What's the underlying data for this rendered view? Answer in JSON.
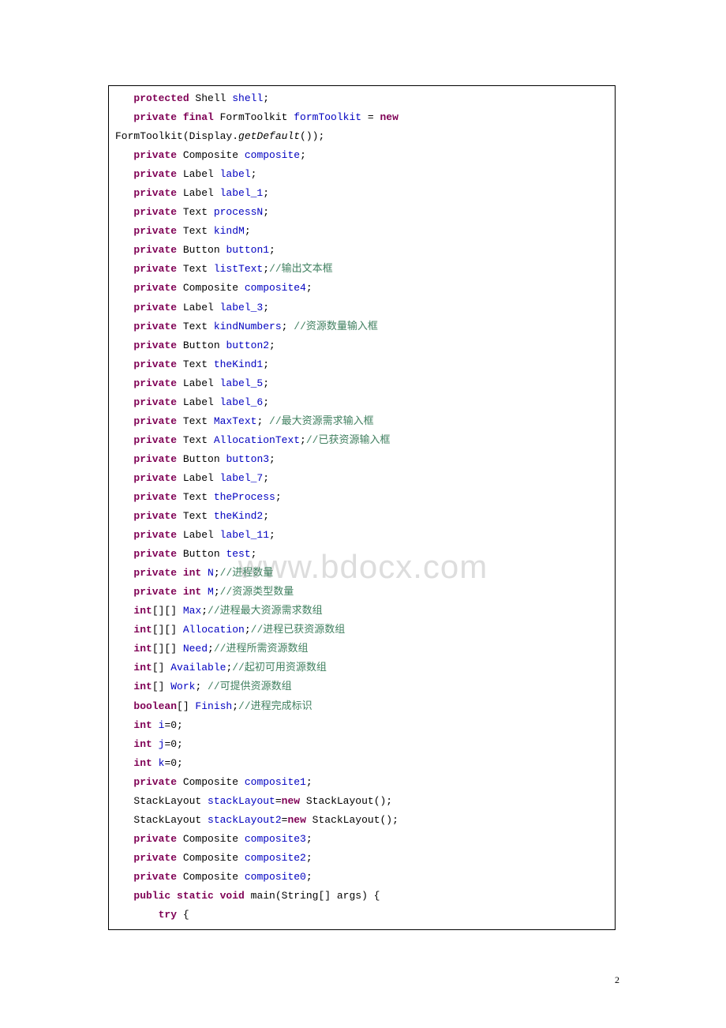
{
  "watermark": "www.bdocx.com",
  "page_number": "2",
  "lines": [
    [
      {
        "t": "   "
      },
      {
        "t": "protected",
        "c": "kw"
      },
      {
        "t": " Shell "
      },
      {
        "t": "shell",
        "c": "fld"
      },
      {
        "t": ";"
      }
    ],
    [
      {
        "t": "   "
      },
      {
        "t": "private final",
        "c": "kw"
      },
      {
        "t": " FormToolkit "
      },
      {
        "t": "formToolkit",
        "c": "fld"
      },
      {
        "t": " = "
      },
      {
        "t": "new",
        "c": "kw"
      }
    ],
    [
      {
        "t": "FormToolkit(Display."
      },
      {
        "t": "getDefault",
        "c": "sit"
      },
      {
        "t": "());"
      }
    ],
    [
      {
        "t": "   "
      },
      {
        "t": "private",
        "c": "kw"
      },
      {
        "t": " Composite "
      },
      {
        "t": "composite",
        "c": "fld"
      },
      {
        "t": ";"
      }
    ],
    [
      {
        "t": "   "
      },
      {
        "t": "private",
        "c": "kw"
      },
      {
        "t": " Label "
      },
      {
        "t": "label",
        "c": "fld"
      },
      {
        "t": ";"
      }
    ],
    [
      {
        "t": "   "
      },
      {
        "t": "private",
        "c": "kw"
      },
      {
        "t": " Label "
      },
      {
        "t": "label_1",
        "c": "fld"
      },
      {
        "t": ";"
      }
    ],
    [
      {
        "t": "   "
      },
      {
        "t": "private",
        "c": "kw"
      },
      {
        "t": " Text "
      },
      {
        "t": "processN",
        "c": "fld"
      },
      {
        "t": ";"
      }
    ],
    [
      {
        "t": "   "
      },
      {
        "t": "private",
        "c": "kw"
      },
      {
        "t": " Text "
      },
      {
        "t": "kindM",
        "c": "fld"
      },
      {
        "t": ";"
      }
    ],
    [
      {
        "t": "   "
      },
      {
        "t": "private",
        "c": "kw"
      },
      {
        "t": " Button "
      },
      {
        "t": "button1",
        "c": "fld"
      },
      {
        "t": ";"
      }
    ],
    [
      {
        "t": "   "
      },
      {
        "t": "private",
        "c": "kw"
      },
      {
        "t": " Text "
      },
      {
        "t": "listText",
        "c": "fld"
      },
      {
        "t": ";"
      },
      {
        "t": "//输出文本框",
        "c": "cm"
      }
    ],
    [
      {
        "t": "   "
      },
      {
        "t": "private",
        "c": "kw"
      },
      {
        "t": " Composite "
      },
      {
        "t": "composite4",
        "c": "fld"
      },
      {
        "t": ";"
      }
    ],
    [
      {
        "t": "   "
      },
      {
        "t": "private",
        "c": "kw"
      },
      {
        "t": " Label "
      },
      {
        "t": "label_3",
        "c": "fld"
      },
      {
        "t": ";"
      }
    ],
    [
      {
        "t": "   "
      },
      {
        "t": "private",
        "c": "kw"
      },
      {
        "t": " Text "
      },
      {
        "t": "kindNumbers",
        "c": "fld"
      },
      {
        "t": "; "
      },
      {
        "t": "//资源数量输入框",
        "c": "cm"
      }
    ],
    [
      {
        "t": "   "
      },
      {
        "t": "private",
        "c": "kw"
      },
      {
        "t": " Button "
      },
      {
        "t": "button2",
        "c": "fld"
      },
      {
        "t": ";"
      }
    ],
    [
      {
        "t": "   "
      },
      {
        "t": "private",
        "c": "kw"
      },
      {
        "t": " Text "
      },
      {
        "t": "theKind1",
        "c": "fld"
      },
      {
        "t": ";"
      }
    ],
    [
      {
        "t": "   "
      },
      {
        "t": "private",
        "c": "kw"
      },
      {
        "t": " Label "
      },
      {
        "t": "label_5",
        "c": "fld"
      },
      {
        "t": ";"
      }
    ],
    [
      {
        "t": "   "
      },
      {
        "t": "private",
        "c": "kw"
      },
      {
        "t": " Label "
      },
      {
        "t": "label_6",
        "c": "fld"
      },
      {
        "t": ";"
      }
    ],
    [
      {
        "t": "   "
      },
      {
        "t": "private",
        "c": "kw"
      },
      {
        "t": " Text "
      },
      {
        "t": "MaxText",
        "c": "fld"
      },
      {
        "t": "; "
      },
      {
        "t": "//最大资源需求输入框",
        "c": "cm"
      }
    ],
    [
      {
        "t": "   "
      },
      {
        "t": "private",
        "c": "kw"
      },
      {
        "t": " Text "
      },
      {
        "t": "AllocationText",
        "c": "fld"
      },
      {
        "t": ";"
      },
      {
        "t": "//已获资源输入框",
        "c": "cm"
      }
    ],
    [
      {
        "t": "   "
      },
      {
        "t": "private",
        "c": "kw"
      },
      {
        "t": " Button "
      },
      {
        "t": "button3",
        "c": "fld"
      },
      {
        "t": ";"
      }
    ],
    [
      {
        "t": "   "
      },
      {
        "t": "private",
        "c": "kw"
      },
      {
        "t": " Label "
      },
      {
        "t": "label_7",
        "c": "fld"
      },
      {
        "t": ";"
      }
    ],
    [
      {
        "t": "   "
      },
      {
        "t": "private",
        "c": "kw"
      },
      {
        "t": " Text "
      },
      {
        "t": "theProcess",
        "c": "fld"
      },
      {
        "t": ";"
      }
    ],
    [
      {
        "t": "   "
      },
      {
        "t": "private",
        "c": "kw"
      },
      {
        "t": " Text "
      },
      {
        "t": "theKind2",
        "c": "fld"
      },
      {
        "t": ";"
      }
    ],
    [
      {
        "t": "   "
      },
      {
        "t": "private",
        "c": "kw"
      },
      {
        "t": " Label "
      },
      {
        "t": "label_11",
        "c": "fld"
      },
      {
        "t": ";"
      }
    ],
    [
      {
        "t": "   "
      },
      {
        "t": "private",
        "c": "kw"
      },
      {
        "t": " Button "
      },
      {
        "t": "test",
        "c": "fld"
      },
      {
        "t": ";"
      }
    ],
    [
      {
        "t": "   "
      },
      {
        "t": "private int",
        "c": "kw"
      },
      {
        "t": " "
      },
      {
        "t": "N",
        "c": "fld"
      },
      {
        "t": ";"
      },
      {
        "t": "//进程数量",
        "c": "cm"
      }
    ],
    [
      {
        "t": "   "
      },
      {
        "t": "private int",
        "c": "kw"
      },
      {
        "t": " "
      },
      {
        "t": "M",
        "c": "fld"
      },
      {
        "t": ";"
      },
      {
        "t": "//资源类型数量",
        "c": "cm"
      }
    ],
    [
      {
        "t": "   "
      },
      {
        "t": "int",
        "c": "kw"
      },
      {
        "t": "[][] "
      },
      {
        "t": "Max",
        "c": "fld"
      },
      {
        "t": ";"
      },
      {
        "t": "//进程最大资源需求数组",
        "c": "cm"
      }
    ],
    [
      {
        "t": "   "
      },
      {
        "t": "int",
        "c": "kw"
      },
      {
        "t": "[][] "
      },
      {
        "t": "Allocation",
        "c": "fld"
      },
      {
        "t": ";"
      },
      {
        "t": "//进程已获资源数组",
        "c": "cm"
      }
    ],
    [
      {
        "t": "   "
      },
      {
        "t": "int",
        "c": "kw"
      },
      {
        "t": "[][] "
      },
      {
        "t": "Need",
        "c": "fld"
      },
      {
        "t": ";"
      },
      {
        "t": "//进程所需资源数组",
        "c": "cm"
      }
    ],
    [
      {
        "t": "   "
      },
      {
        "t": "int",
        "c": "kw"
      },
      {
        "t": "[] "
      },
      {
        "t": "Available",
        "c": "fld"
      },
      {
        "t": ";"
      },
      {
        "t": "//起初可用资源数组",
        "c": "cm"
      }
    ],
    [
      {
        "t": "   "
      },
      {
        "t": "int",
        "c": "kw"
      },
      {
        "t": "[] "
      },
      {
        "t": "Work",
        "c": "fld"
      },
      {
        "t": "; "
      },
      {
        "t": "//可提供资源数组",
        "c": "cm"
      }
    ],
    [
      {
        "t": "   "
      },
      {
        "t": "boolean",
        "c": "kw"
      },
      {
        "t": "[] "
      },
      {
        "t": "Finish",
        "c": "fld"
      },
      {
        "t": ";"
      },
      {
        "t": "//进程完成标识",
        "c": "cm"
      }
    ],
    [
      {
        "t": "   "
      },
      {
        "t": "int",
        "c": "kw"
      },
      {
        "t": " "
      },
      {
        "t": "i",
        "c": "fld"
      },
      {
        "t": "=0;"
      }
    ],
    [
      {
        "t": "   "
      },
      {
        "t": "int",
        "c": "kw"
      },
      {
        "t": " "
      },
      {
        "t": "j",
        "c": "fld"
      },
      {
        "t": "=0;"
      }
    ],
    [
      {
        "t": "   "
      },
      {
        "t": "int",
        "c": "kw"
      },
      {
        "t": " "
      },
      {
        "t": "k",
        "c": "fld"
      },
      {
        "t": "=0;"
      }
    ],
    [
      {
        "t": "   "
      },
      {
        "t": "private",
        "c": "kw"
      },
      {
        "t": " Composite "
      },
      {
        "t": "composite1",
        "c": "fld"
      },
      {
        "t": ";"
      }
    ],
    [
      {
        "t": "   StackLayout "
      },
      {
        "t": "stackLayout",
        "c": "fld"
      },
      {
        "t": "="
      },
      {
        "t": "new",
        "c": "kw"
      },
      {
        "t": " StackLayout();"
      }
    ],
    [
      {
        "t": "   StackLayout "
      },
      {
        "t": "stackLayout2",
        "c": "fld"
      },
      {
        "t": "="
      },
      {
        "t": "new",
        "c": "kw"
      },
      {
        "t": " StackLayout();"
      }
    ],
    [
      {
        "t": "   "
      },
      {
        "t": "private",
        "c": "kw"
      },
      {
        "t": " Composite "
      },
      {
        "t": "composite3",
        "c": "fld"
      },
      {
        "t": ";"
      }
    ],
    [
      {
        "t": "   "
      },
      {
        "t": "private",
        "c": "kw"
      },
      {
        "t": " Composite "
      },
      {
        "t": "composite2",
        "c": "fld"
      },
      {
        "t": ";"
      }
    ],
    [
      {
        "t": "   "
      },
      {
        "t": "private",
        "c": "kw"
      },
      {
        "t": " Composite "
      },
      {
        "t": "composite0",
        "c": "fld"
      },
      {
        "t": ";"
      }
    ],
    [
      {
        "t": "   "
      },
      {
        "t": "public static void",
        "c": "kw"
      },
      {
        "t": " main(String[] args) {"
      }
    ],
    [
      {
        "t": "       "
      },
      {
        "t": "try",
        "c": "kw"
      },
      {
        "t": " {"
      }
    ]
  ]
}
